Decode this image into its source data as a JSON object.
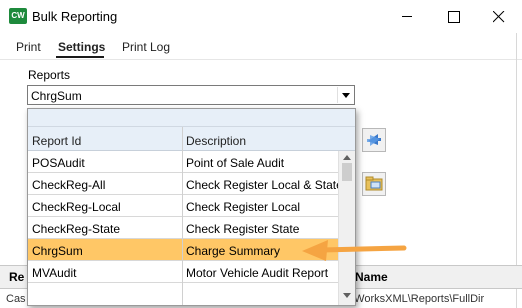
{
  "window": {
    "app_icon_text": "CW",
    "title": "Bulk Reporting"
  },
  "tabs": [
    {
      "label": "Print",
      "active": false
    },
    {
      "label": "Settings",
      "active": true
    },
    {
      "label": "Print Log",
      "active": false
    }
  ],
  "reports": {
    "label": "Reports",
    "selected_value": "ChrgSum"
  },
  "dropdown": {
    "columns": [
      "Report Id",
      "Description"
    ],
    "rows": [
      {
        "id": "POSAudit",
        "description": "Point of Sale Audit",
        "selected": false
      },
      {
        "id": "CheckReg-All",
        "description": "Check Register Local & State",
        "selected": false
      },
      {
        "id": "CheckReg-Local",
        "description": "Check Register Local",
        "selected": false
      },
      {
        "id": "CheckReg-State",
        "description": "Check Register State",
        "selected": false
      },
      {
        "id": "ChrgSum",
        "description": "Charge Summary",
        "selected": true
      },
      {
        "id": "MVAudit",
        "description": "Motor Vehicle Audit Report",
        "selected": false
      }
    ]
  },
  "grid": {
    "header_left": "Re",
    "header_right": "rt Name",
    "cell_left": "Cas",
    "cell_right": "rkWorksXML\\Reports\\FullDir"
  },
  "annotation": {
    "arrow_color": "#f5a442"
  },
  "colors": {
    "selected_row": "#ffc766",
    "header_bg": "#e7eff8"
  }
}
